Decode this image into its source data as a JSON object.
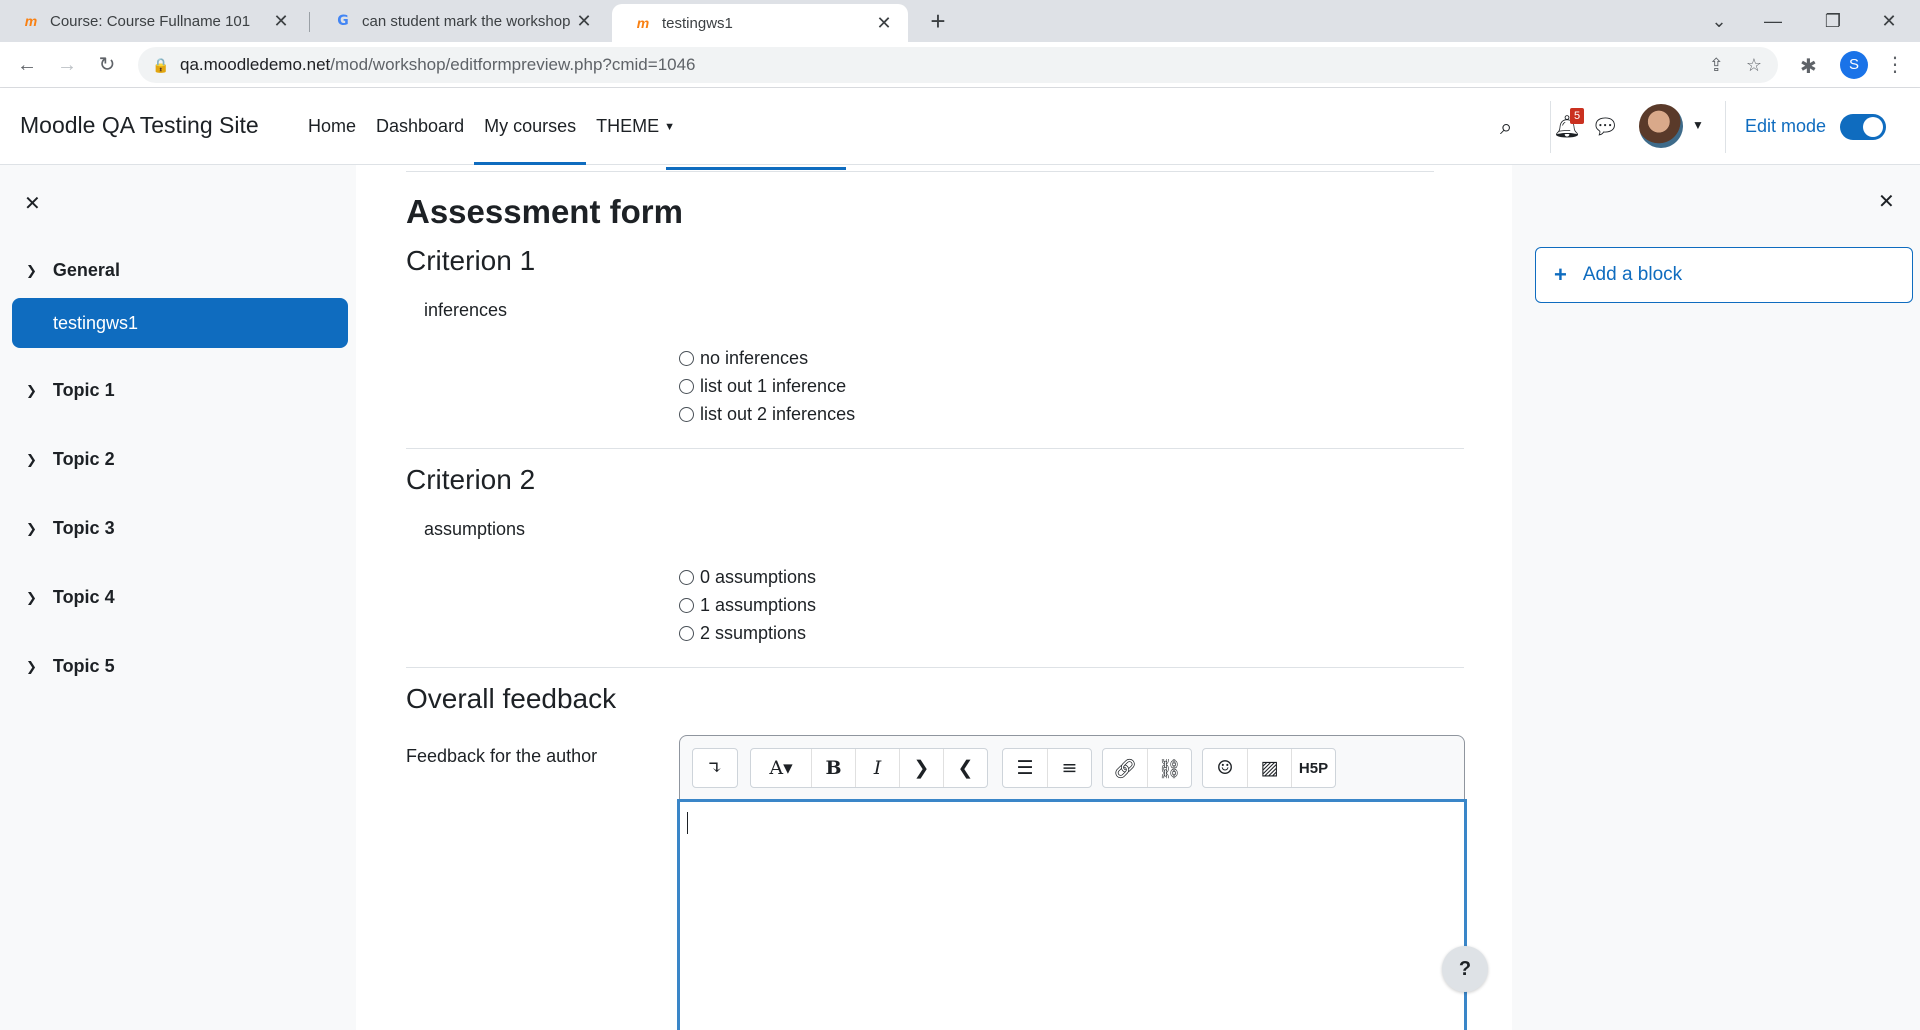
{
  "browser": {
    "tabs": [
      {
        "title": "Course: Course Fullname 101",
        "favicon": "moodle-icon",
        "active": false
      },
      {
        "title": "can student mark the workshop a",
        "favicon": "google-icon",
        "active": false
      },
      {
        "title": "testingws1",
        "favicon": "moodle-icon",
        "active": true
      }
    ],
    "url_host": "qa.moodledemo.net",
    "url_path": "/mod/workshop/editformpreview.php?cmid=1046",
    "profile_initial": "S"
  },
  "navbar": {
    "site_name": "Moodle QA Testing Site",
    "items": [
      {
        "label": "Home",
        "active": false
      },
      {
        "label": "Dashboard",
        "active": false
      },
      {
        "label": "My courses",
        "active": true
      },
      {
        "label": "THEME",
        "active": false
      }
    ],
    "notification_count": "5",
    "edit_mode_label": "Edit mode"
  },
  "course_index": {
    "sections": [
      {
        "label": "General"
      },
      {
        "label": "Topic 1"
      },
      {
        "label": "Topic 2"
      },
      {
        "label": "Topic 3"
      },
      {
        "label": "Topic 4"
      },
      {
        "label": "Topic 5"
      }
    ],
    "active_activity": "testingws1"
  },
  "form": {
    "heading": "Assessment form",
    "criteria": [
      {
        "title": "Criterion 1",
        "description": "inferences",
        "options": [
          "no inferences",
          "list out 1 inference",
          "list out 2 inferences"
        ]
      },
      {
        "title": "Criterion 2",
        "description": "assumptions",
        "options": [
          "0 assumptions",
          "1 assumptions",
          "2 ssumptions"
        ]
      }
    ],
    "overall_heading": "Overall feedback",
    "feedback_label": "Feedback for the author",
    "h5p_label": "H5P"
  },
  "blocks": {
    "add_block_label": "Add a block"
  },
  "help_label": "?"
}
